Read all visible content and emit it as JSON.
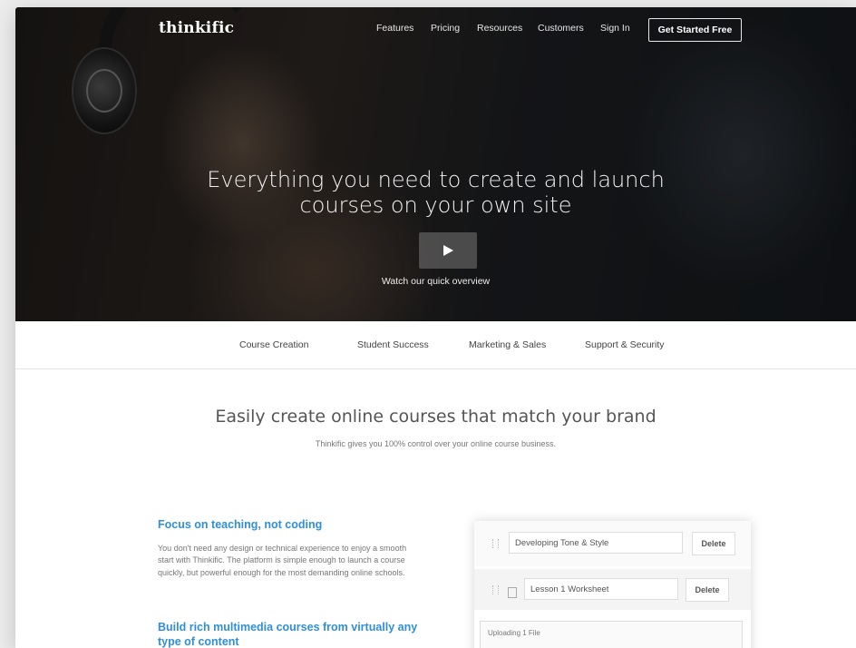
{
  "header": {
    "logo": "thinkific",
    "nav": [
      "Features",
      "Pricing",
      "Resources",
      "Customers",
      "Sign In"
    ],
    "cta": "Get Started Free"
  },
  "hero": {
    "title": "Everything you need to create and launch\ncourses on your own site",
    "video_label": "Watch our quick overview"
  },
  "tabs": [
    "Course Creation",
    "Student Success",
    "Marketing & Sales",
    "Support & Security"
  ],
  "section": {
    "title": "Easily create online courses that match your brand",
    "subtitle": "Thinkific gives you 100% control over your online course business."
  },
  "features": [
    {
      "heading": "Focus on teaching, not coding",
      "body": "You don't need any design or technical experience to enjoy a smooth start with Thinkific. The platform is simple enough to launch a course quickly, but powerful enough for the most demanding online schools."
    },
    {
      "heading": "Build rich multimedia courses from virtually any type of content"
    }
  ],
  "editor": {
    "item1": "Developing Tone & Style",
    "item2": "Lesson 1 Worksheet",
    "delete_label": "Delete",
    "upload_status": "Uploading 1 File"
  },
  "colors": {
    "accent": "#2f8fd8",
    "cta_border": "#e8e8e8"
  }
}
